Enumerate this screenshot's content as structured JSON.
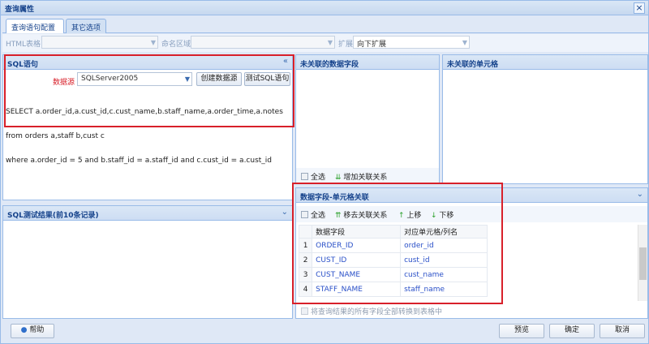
{
  "window": {
    "title": "查询属性",
    "close": "×"
  },
  "tabs": [
    {
      "label": "查询语句配置"
    },
    {
      "label": "其它选项"
    }
  ],
  "filters": {
    "html_table_label": "HTML表格",
    "name_area_label": "命名区域",
    "expand_label": "扩展",
    "expand_value": "向下扩展"
  },
  "sql_panel": {
    "title": "SQL语句",
    "datasource_label": "数据源",
    "datasource_value": "SQLServer2005",
    "create_ds_button": "创建数据源",
    "test_sql_button": "测试SQL语句",
    "sql_lines": [
      "SELECT a.order_id,a.cust_id,c.cust_name,b.staff_name,a.order_time,a.notes",
      "from orders a,staff b,cust c",
      "where a.order_id = 5 and b.staff_id = a.staff_id and c.cust_id = a.cust_id"
    ]
  },
  "test_result_panel": {
    "title": "SQL测试结果(前10条记录)"
  },
  "unlinked_fields_panel": {
    "title": "未关联的数据字段",
    "select_all": "全选",
    "add_link": "增加关联关系"
  },
  "unlinked_cells_panel": {
    "title": "未关联的单元格"
  },
  "mapping_panel": {
    "title": "数据字段-单元格关联",
    "select_all": "全选",
    "remove_link": "移去关联关系",
    "move_up": "上移",
    "move_down": "下移",
    "col_field": "数据字段",
    "col_cell": "对应单元格/列名",
    "rows": [
      {
        "n": "1",
        "field": "ORDER_ID",
        "cell": "order_id"
      },
      {
        "n": "2",
        "field": "CUST_ID",
        "cell": "cust_id"
      },
      {
        "n": "3",
        "field": "CUST_NAME",
        "cell": "cust_name"
      },
      {
        "n": "4",
        "field": "STAFF_NAME",
        "cell": "staff_name"
      }
    ],
    "convert_all_label": "将查询结果的所有字段全部转换到表格中"
  },
  "footer": {
    "help": "帮助",
    "preview": "预览",
    "ok": "确定",
    "cancel": "取消"
  },
  "colors": {
    "highlight_border": "#d8202a",
    "panel_border": "#99bbe8",
    "header_text": "#15428b"
  }
}
